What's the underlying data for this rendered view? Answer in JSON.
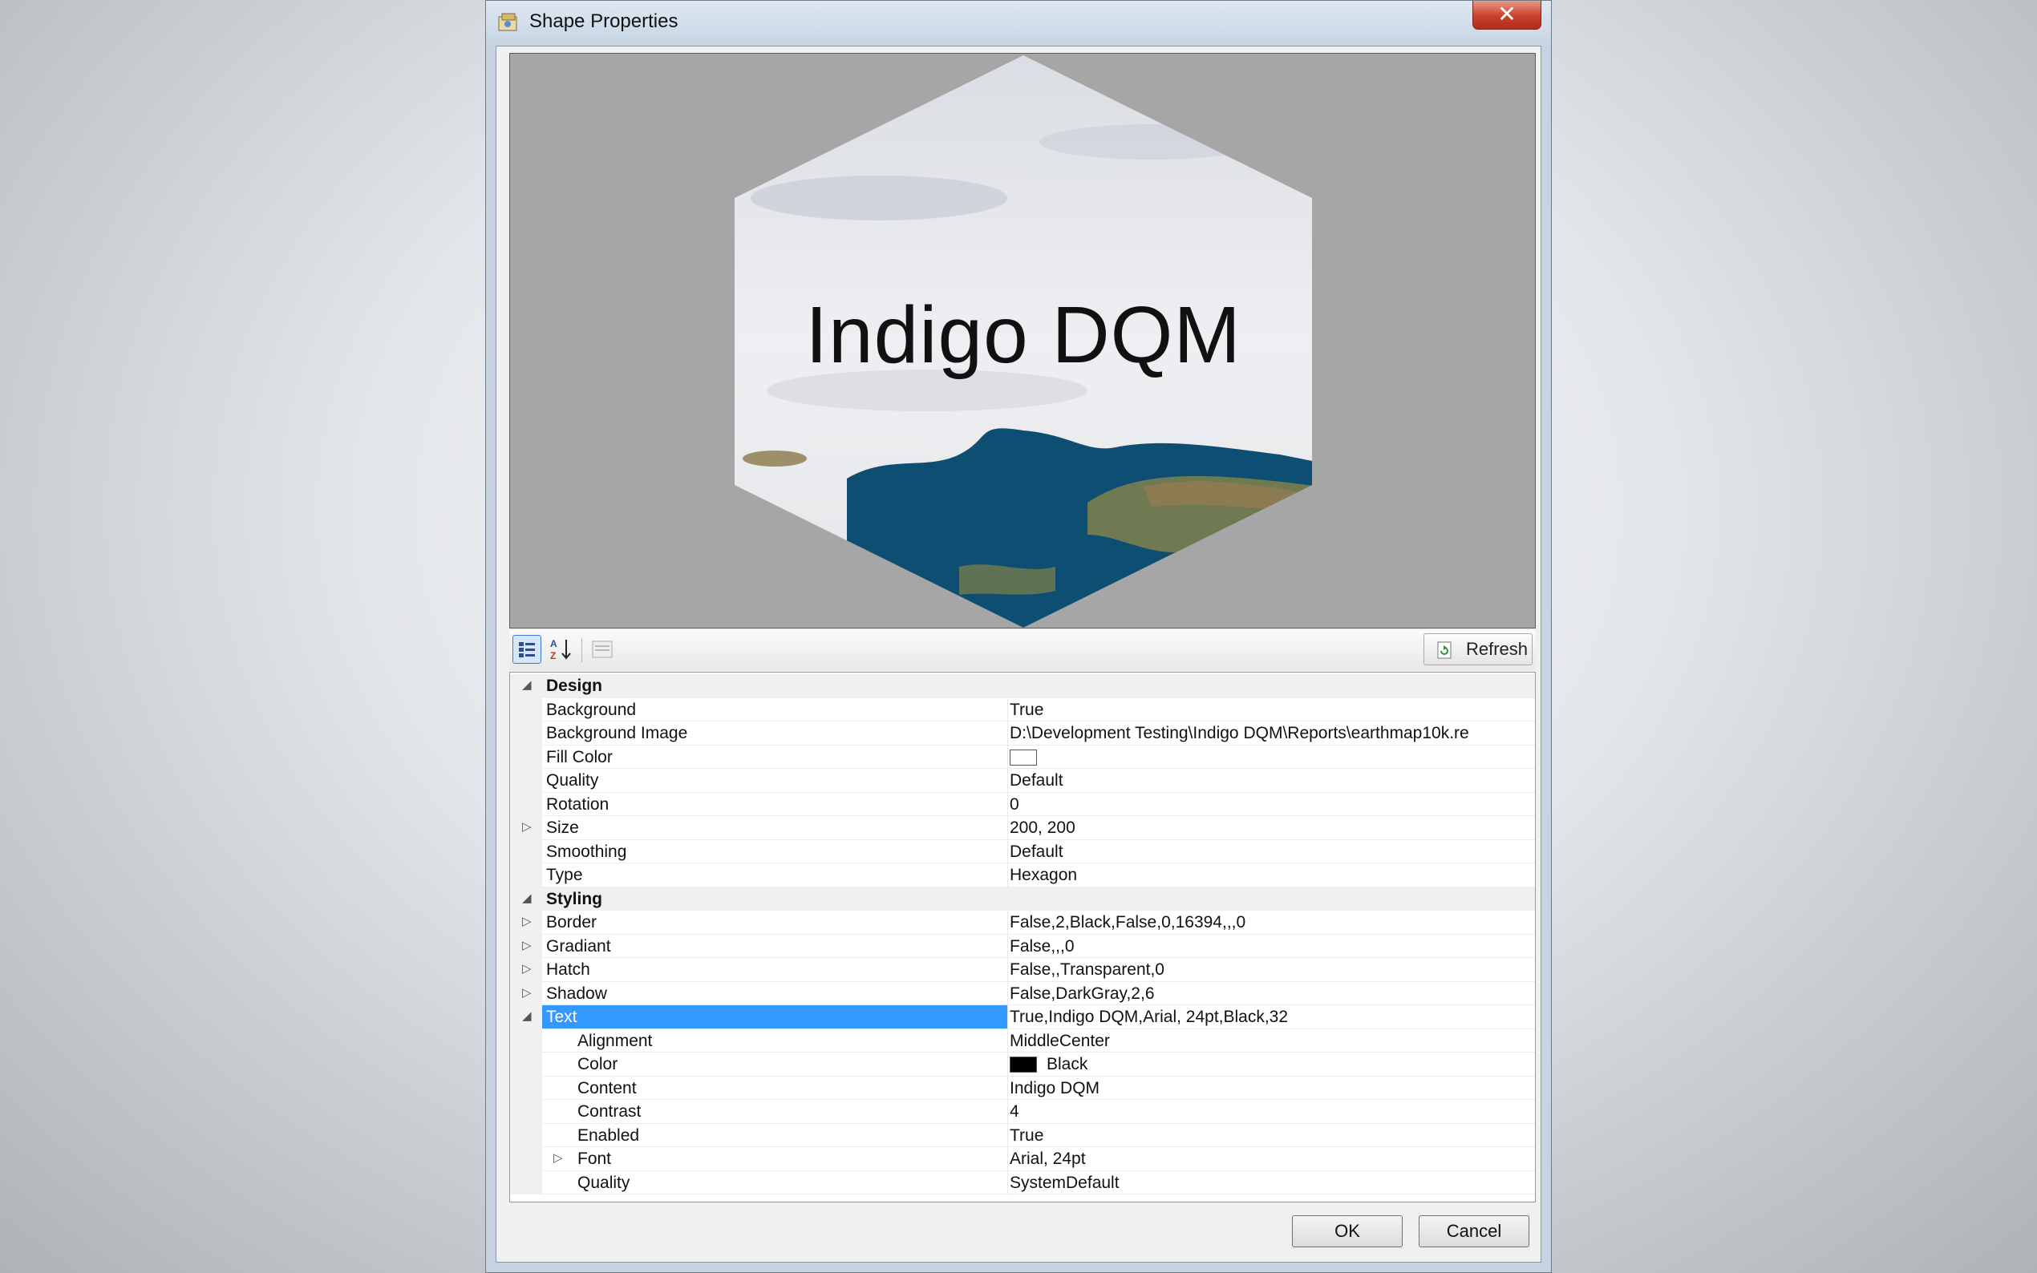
{
  "dialog": {
    "title": "Shape Properties",
    "close_glyph": "✕"
  },
  "preview": {
    "text": "Indigo DQM"
  },
  "toolbar": {
    "refresh_label": "Refresh"
  },
  "grid": {
    "rows": [
      {
        "kind": "category",
        "expander": "◢",
        "name": "Design",
        "value": ""
      },
      {
        "kind": "prop",
        "expander": "",
        "name": "Background",
        "value": "True"
      },
      {
        "kind": "prop",
        "expander": "",
        "name": "Background Image",
        "value": "D:\\Development Testing\\Indigo DQM\\Reports\\earthmap10k.re"
      },
      {
        "kind": "prop",
        "expander": "",
        "name": "Fill Color",
        "value": "",
        "swatch": "#ffffff"
      },
      {
        "kind": "prop",
        "expander": "",
        "name": "Quality",
        "value": "Default"
      },
      {
        "kind": "prop",
        "expander": "",
        "name": "Rotation",
        "value": "0"
      },
      {
        "kind": "prop",
        "expander": "▷",
        "name": "Size",
        "value": "200, 200"
      },
      {
        "kind": "prop",
        "expander": "",
        "name": "Smoothing",
        "value": "Default"
      },
      {
        "kind": "prop",
        "expander": "",
        "name": "Type",
        "value": "Hexagon"
      },
      {
        "kind": "category",
        "expander": "◢",
        "name": "Styling",
        "value": ""
      },
      {
        "kind": "prop",
        "expander": "▷",
        "name": "Border",
        "value": "False,2,Black,False,0,16394,,,0"
      },
      {
        "kind": "prop",
        "expander": "▷",
        "name": "Gradiant",
        "value": "False,,,0"
      },
      {
        "kind": "prop",
        "expander": "▷",
        "name": "Hatch",
        "value": "False,,Transparent,0"
      },
      {
        "kind": "prop",
        "expander": "▷",
        "name": "Shadow",
        "value": "False,DarkGray,2,6"
      },
      {
        "kind": "prop",
        "expander": "◢",
        "name": "Text",
        "value": "True,Indigo DQM,Arial, 24pt,Black,32",
        "selected": true
      },
      {
        "kind": "sub",
        "expander": "",
        "name": "Alignment",
        "value": "MiddleCenter"
      },
      {
        "kind": "sub",
        "expander": "",
        "name": "Color",
        "value": "Black",
        "swatch": "#000000"
      },
      {
        "kind": "sub",
        "expander": "",
        "name": "Content",
        "value": "Indigo DQM"
      },
      {
        "kind": "sub",
        "expander": "",
        "name": "Contrast",
        "value": "4"
      },
      {
        "kind": "sub",
        "expander": "",
        "name": "Enabled",
        "value": "True"
      },
      {
        "kind": "sub",
        "expander": "▷",
        "name": "Font",
        "value": "Arial, 24pt"
      },
      {
        "kind": "sub",
        "expander": "",
        "name": "Quality",
        "value": "SystemDefault"
      }
    ]
  },
  "buttons": {
    "ok_label": "OK",
    "cancel_label": "Cancel"
  },
  "colors": {
    "selection": "#3399ff",
    "preview_background": "#a6a6a6"
  }
}
